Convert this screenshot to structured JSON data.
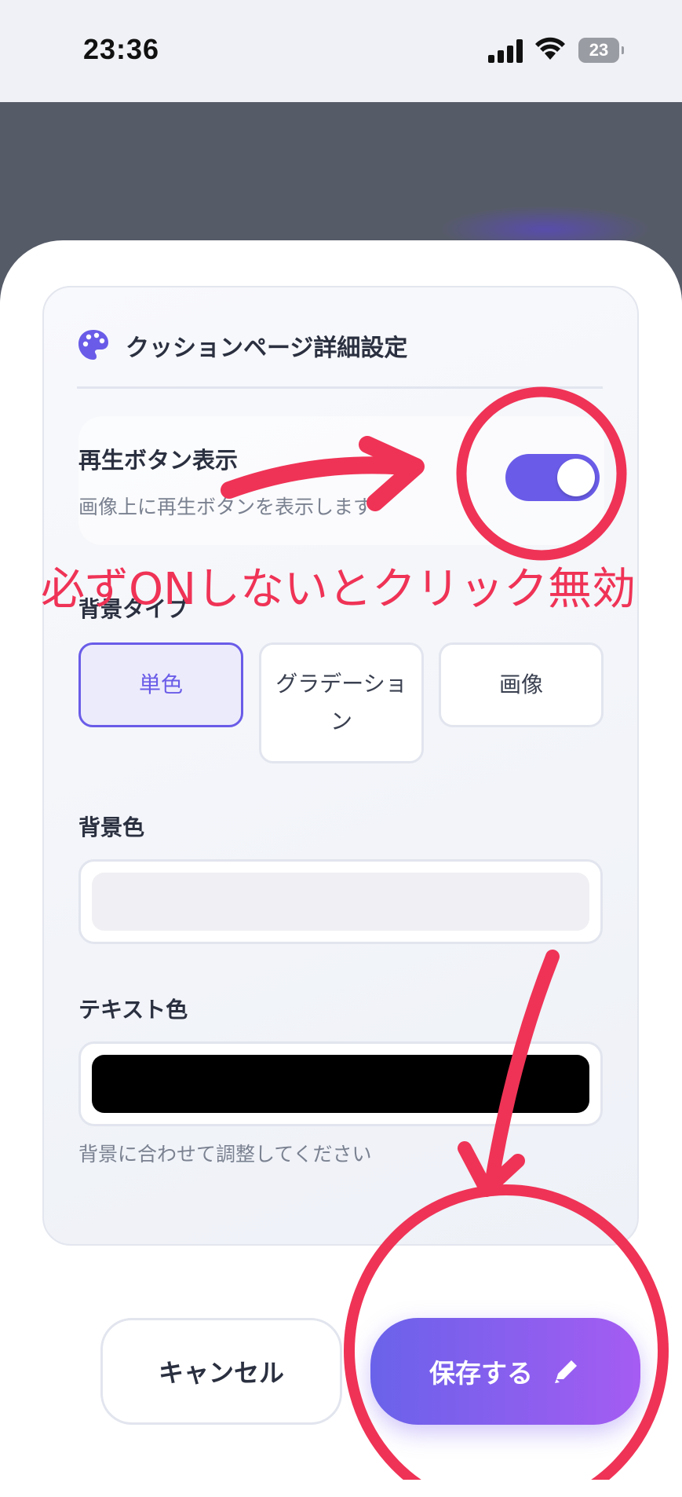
{
  "status_bar": {
    "time": "23:36",
    "battery_level": "23"
  },
  "card": {
    "title": "クッションページ詳細設定",
    "play_button": {
      "label": "再生ボタン表示",
      "description": "画像上に再生ボタンを表示します",
      "enabled": true
    },
    "background_type": {
      "label": "背景タイプ",
      "options": [
        "単色",
        "グラデーション",
        "画像"
      ],
      "selected": "単色"
    },
    "background_color": {
      "label": "背景色",
      "value": "#f0f0f4"
    },
    "text_color": {
      "label": "テキスト色",
      "value": "#000000"
    },
    "hint": "背景に合わせて調整してください"
  },
  "buttons": {
    "cancel": "キャンセル",
    "save": "保存する"
  },
  "annotation": {
    "text": "必ずONしないとクリック無効",
    "color": "#ef3356"
  },
  "colors": {
    "accent": "#6a5ce8",
    "save_gradient_start": "#6a62ea",
    "save_gradient_end": "#a55cf2"
  }
}
